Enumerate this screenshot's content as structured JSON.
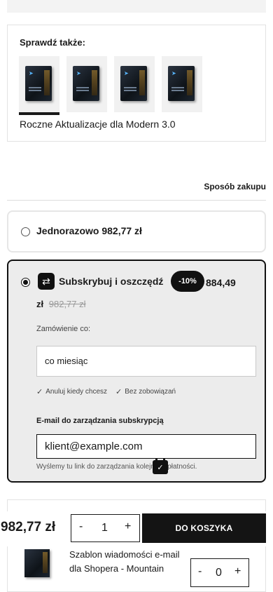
{
  "related": {
    "title": "Sprawdź także:",
    "caption": "Roczne Aktualizacje dla Modern 3.0",
    "thumbnails": [
      {
        "name": "product-thumbnail-1",
        "active": true
      },
      {
        "name": "product-thumbnail-2",
        "active": false
      },
      {
        "name": "product-thumbnail-3",
        "active": false
      },
      {
        "name": "product-thumbnail-4",
        "active": false
      }
    ]
  },
  "purchase": {
    "heading": "Sposób zakupu",
    "one_time": {
      "label": "Jednorazowo 982,77 zł",
      "selected": false
    },
    "subscription": {
      "label": "Subskrybuj i oszczędź",
      "selected": true,
      "discount_badge": "-10%",
      "price": "884,49",
      "currency": "zł",
      "old_price": "982,77 zł",
      "frequency_label": "Zamówienie co:",
      "frequency_value": "co miesiąc",
      "perks": [
        "Anuluj kiedy chcesz",
        "Bez zobowiązań"
      ],
      "email_label": "E-mail do zarządzania subskrypcją",
      "email_value": "klient@example.com",
      "email_note": "Wyślemy tu link do zarządzania kolejnych płatności."
    }
  },
  "cart_bar": {
    "price": "982,77 zł",
    "qty_minus": "-",
    "qty_value": "1",
    "qty_plus": "+",
    "add_to_cart_label": "DO KOSZYKA"
  },
  "bundle_item": {
    "name": "Szablon wiadomości e-mail dla Shopera - Mountain",
    "qty_minus": "-",
    "qty_value": "0",
    "qty_plus": "+"
  },
  "icons": {
    "subscription": "repeat-icon",
    "check": "check-icon",
    "calendar": "calendar-check-icon"
  },
  "colors": {
    "accent": "#111111",
    "subscription_bg": "#ececec",
    "old_price": "#9a9a9a"
  }
}
